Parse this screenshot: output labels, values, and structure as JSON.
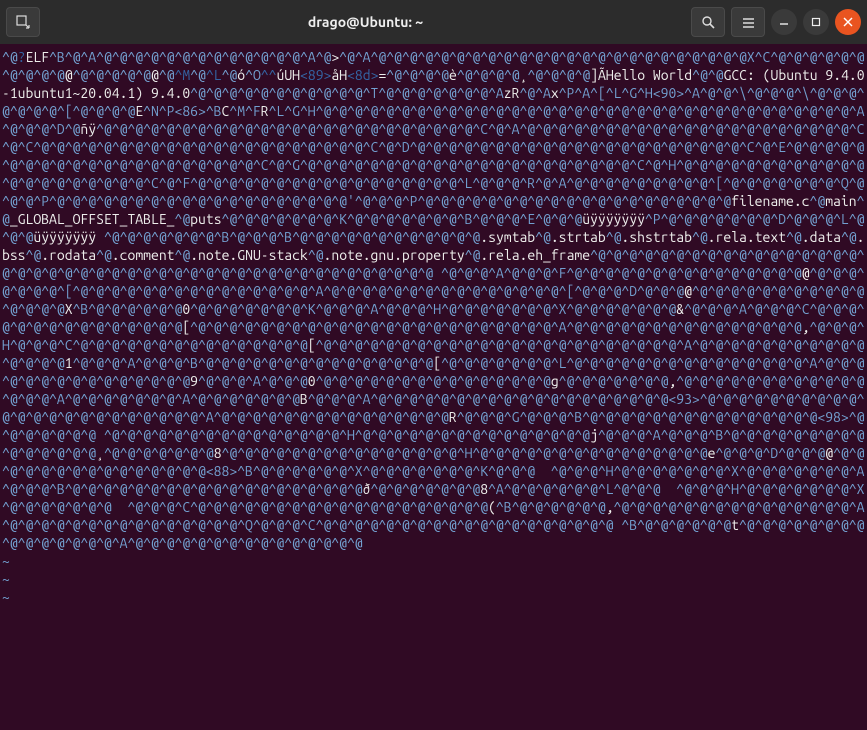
{
  "window": {
    "title": "drago@Ubuntu: ~"
  },
  "content": {
    "tokens": [
      {
        "c": "ctrl",
        "t": "^@"
      },
      {
        "c": "brkt",
        "t": "?"
      },
      {
        "c": "txt",
        "t": "ELF"
      },
      {
        "c": "ctrl",
        "t": "^B^@^A^@^@^@^@^@^@^@^@^@^@^@^@^@^A^@"
      },
      {
        "c": "txt",
        "t": ">"
      },
      {
        "c": "ctrl",
        "t": "^@^A^@^@^@^@^@^@^@^@^@^@^@^@^@^@^@^@^@^@^@^@^@^@^@^@X^C^@^@^@^@^@^@^@^@^@^@"
      },
      {
        "c": "txt",
        "t": "@"
      },
      {
        "c": "ctrl",
        "t": "^@^@^@^@^@"
      },
      {
        "c": "txt",
        "t": "@"
      },
      {
        "c": "ctrl",
        "t": "^@"
      },
      {
        "c": "brkt",
        "t": "^M"
      },
      {
        "c": "ctrl",
        "t": "^@"
      },
      {
        "c": "brkt",
        "t": "^L"
      },
      {
        "c": "ctrl",
        "t": "^@"
      },
      {
        "c": "txt",
        "t": "ó"
      },
      {
        "c": "ctrl",
        "t": "^O"
      },
      {
        "c": "brkt",
        "t": "^^"
      },
      {
        "c": "txt",
        "t": "úUH"
      },
      {
        "c": "brkt",
        "t": "<89>"
      },
      {
        "c": "txt",
        "t": "åH"
      },
      {
        "c": "brkt",
        "t": "<8d>"
      },
      {
        "c": "txt",
        "t": "="
      },
      {
        "c": "ctrl",
        "t": "^@^@^@^@"
      },
      {
        "c": "txt",
        "t": "è"
      },
      {
        "c": "ctrl",
        "t": "^@^@^@^@"
      },
      {
        "c": "txt",
        "t": "¸"
      },
      {
        "c": "ctrl",
        "t": "^@^@^@^@"
      },
      {
        "c": "txt",
        "t": "]ÃHello World"
      },
      {
        "c": "ctrl",
        "t": "^@^@"
      },
      {
        "c": "txt",
        "t": "GCC: (Ubuntu 9.4.0-1ubuntu1~20.04.1) 9.4.0"
      },
      {
        "c": "ctrl",
        "t": "^@^@^@^@^@^@^@^@^@^@^@^T^@^@^@^@^@^@^@^A"
      },
      {
        "c": "txt",
        "t": "zR"
      },
      {
        "c": "ctrl",
        "t": "^@^A"
      },
      {
        "c": "txt",
        "t": "x"
      },
      {
        "c": "ctrl",
        "t": "^P^A^[^L^G^H<90>^A^@^@^\\^@^@^@^\\^@^@^@^@^@^@^@^[^@^@^@^@"
      },
      {
        "c": "txt",
        "t": "E"
      },
      {
        "c": "ctrl",
        "t": "^N^P<86>^B"
      },
      {
        "c": "txt",
        "t": "C"
      },
      {
        "c": "ctrl",
        "t": "^M^F"
      },
      {
        "c": "txt",
        "t": "R"
      },
      {
        "c": "ctrl",
        "t": "^L^G^H^@^@^@^@^@^@^@^@^@^@^@^@^@^@^@^@^@^@^@^@^@^@^@^@^@^@^@^@^@^@^@^@^@^@^A^@^@^@^D^@"
      },
      {
        "c": "txt",
        "t": "ñÿ"
      },
      {
        "c": "ctrl",
        "t": "^@^@^@^@^@^@^@^@^@^@^@^@^@^@^@^@^@^@^@^@^@^@^@^@^C^@^A^@^@^@^@^@^@^@^@^@^@^@^@^@^@^@^@^@^@^@^@^@^C^@^C^@^@^@^@^@^@^@^@^@^@^@^@^@^@^@^@^@^@^@^@^@^C^@^D^@^@^@^@^@^@^@^@^@^@^@^@^@^@^@^@^@^@^@^@^@^C^@^E^@^@^@^@^@^@^@^@^@^@^@^@^@^@^@^@^@^@^@^@^@^C^@^G^@^@^@^@^@^@^@^@^@^@^@^@^@^@^@^@^@^@^@^@^@^C^@^H^@^@^@^@^@^@^@^@^@^@^@^@^@^@^@^@^@^@^@^@^@^C^@^F^@^@^@^@^@^@^@^@^@^@^@^@^@^@^@^@^@^L^@^@^@^R^@^A^@^@^@^@^@^@^@^@^@^[^@^@^@^@^@^@^@^Q^@^@^@^P^@^@^@^@^@^@^@^@^@^@^@^@^@^@^@^@^@^@^@'^@^@^@^P^@^@^@^@^@^@^@^@^@^@^@^@^@^@^@^@^@^@^@^@"
      },
      {
        "c": "txt",
        "t": "filename.c"
      },
      {
        "c": "ctrl",
        "t": "^@"
      },
      {
        "c": "txt",
        "t": "main"
      },
      {
        "c": "ctrl",
        "t": "^@"
      },
      {
        "c": "txt",
        "t": "_GLOBAL_OFFSET_TABLE_"
      },
      {
        "c": "ctrl",
        "t": "^@"
      },
      {
        "c": "txt",
        "t": "puts"
      },
      {
        "c": "ctrl",
        "t": "^@^@^@^@^@^@^@^K^@^@^@^@^@^@^@^B^@^@^@^E^@^@^@"
      },
      {
        "c": "txt",
        "t": "üÿÿÿÿÿÿÿ"
      },
      {
        "c": "ctrl",
        "t": "^P^@^@^@^@^@^@^@^D^@^@^@^L^@^@^@"
      },
      {
        "c": "txt",
        "t": "üÿÿÿÿÿÿÿ "
      },
      {
        "c": "ctrl",
        "t": "^@^@^@^@^@^@^@^B^@^@^@^B^@^@^@^@^@^@^@^@^@^@^@^@"
      },
      {
        "c": "txt",
        "t": ".symtab"
      },
      {
        "c": "ctrl",
        "t": "^@"
      },
      {
        "c": "txt",
        "t": ".strtab"
      },
      {
        "c": "ctrl",
        "t": "^@"
      },
      {
        "c": "txt",
        "t": ".shstrtab"
      },
      {
        "c": "ctrl",
        "t": "^@"
      },
      {
        "c": "txt",
        "t": ".rela.text"
      },
      {
        "c": "ctrl",
        "t": "^@"
      },
      {
        "c": "txt",
        "t": ".data"
      },
      {
        "c": "ctrl",
        "t": "^@"
      },
      {
        "c": "txt",
        "t": ".bss"
      },
      {
        "c": "ctrl",
        "t": "^@"
      },
      {
        "c": "txt",
        "t": ".rodata"
      },
      {
        "c": "ctrl",
        "t": "^@"
      },
      {
        "c": "txt",
        "t": ".comment"
      },
      {
        "c": "ctrl",
        "t": "^@"
      },
      {
        "c": "txt",
        "t": ".note.GNU-stack"
      },
      {
        "c": "ctrl",
        "t": "^@"
      },
      {
        "c": "txt",
        "t": ".note.gnu.property"
      },
      {
        "c": "ctrl",
        "t": "^@"
      },
      {
        "c": "txt",
        "t": ".rela.eh_frame"
      },
      {
        "c": "ctrl",
        "t": "^@^@^@^@^@^@^@^@^@^@^@^@^@^@^@^@^@^@^@^@^@^@^@^@^@^@^@^@^@^@^@^@^@^@^@^@^@^@^@^@^@^@^@^@^@ ^@^@^@^A^@^@^@^F^@^@^@^@^@^@^@^@^@^@^@^@^@^@^@"
      },
      {
        "c": "txt",
        "t": "@"
      },
      {
        "c": "ctrl",
        "t": "^@^@^@^@^@^@^@^[^@^@^@^@^@^@^@^@^@^@^@^@^@^@^@^A^@^@^@^@^@^@^@^@^@^@^@^@^@^@^@^[^@^@^@^D^@^@^@"
      },
      {
        "c": "txt",
        "t": "@"
      },
      {
        "c": "ctrl",
        "t": "^@^@^@^@^@^@^@^@^@^@^@^@^@^@^@"
      },
      {
        "c": "txt",
        "t": "X"
      },
      {
        "c": "ctrl",
        "t": "^B^@^@^@^@^@^@"
      },
      {
        "c": "txt",
        "t": "0"
      },
      {
        "c": "ctrl",
        "t": "^@^@^@^@^@^@^@^K^@^@^@^A^@^@^@^H^@^@^@^@^@^@^@^X^@^@^@^@^@^@^@"
      },
      {
        "c": "txt",
        "t": "&"
      },
      {
        "c": "ctrl",
        "t": "^@^@^@^A^@^@^@^C^@^@^@^@^@^@^@^@^@^@^@^@^@^@^@"
      },
      {
        "c": "txt",
        "t": "["
      },
      {
        "c": "ctrl",
        "t": "^@^@^@^@^@^@^@^@^@^@^@^@^@^@^@^@^@^@^@^@^@^@^@^A^@^@^@^@^@^@^@^@^@^@^@^@^@^@^@"
      },
      {
        "c": "txt",
        "t": ","
      },
      {
        "c": "ctrl",
        "t": "^@^@^@^H^@^@^@^C^@^@^@^@^@^@^@^@^@^@^@^@^@^@^@"
      },
      {
        "c": "txt",
        "t": "["
      },
      {
        "c": "ctrl",
        "t": "^@^@^@^@^@^@^@^@^@^@^@^@^@^@^@^@^@^@^@^@^@^@^@^A^@^@^@^@^@^@^@^@^@^@^@^@^@^@^@"
      },
      {
        "c": "txt",
        "t": "1"
      },
      {
        "c": "ctrl",
        "t": "^@^@^@^A^@^@^@^B^@^@^@^@^@^@^@^@^@^@^@^@^@^@^@"
      },
      {
        "c": "txt",
        "t": "["
      },
      {
        "c": "ctrl",
        "t": "^@^@^@^@^@^@^@^L^@^@^@^@^@^@^@^@^@^@^@^@^@^@^@^A^@^@^@^@^@^@^@^@^@^@^@^@^@^@^@"
      },
      {
        "c": "txt",
        "t": "9"
      },
      {
        "c": "ctrl",
        "t": "^@^@^@^A^@^@^@"
      },
      {
        "c": "txt",
        "t": "0"
      },
      {
        "c": "ctrl",
        "t": "^@^@^@^@^@^@^@^@^@^@^@^@^@^@^@"
      },
      {
        "c": "txt",
        "t": "g"
      },
      {
        "c": "ctrl",
        "t": "^@^@^@^@^@^@^@"
      },
      {
        "c": "txt",
        "t": ","
      },
      {
        "c": "ctrl",
        "t": "^@^@^@^@^@^@^@^@^@^@^@^@^@^@^@^A^@^@^@^@^@^@^@^A^@^@^@^@^@^@^@"
      },
      {
        "c": "txt",
        "t": "B"
      },
      {
        "c": "ctrl",
        "t": "^@^@^@^A^@^@^@^@^@^@^@^@^@^@^@^@^@^@^@^@^@^@^@<93>^@^@^@^@^@^@^@^@^@^@^@^@^@^@^@^@^@^@^@^@^@^@^@^A^@^@^@^@^@^@^@^@^@^@^@^@^@^@^@"
      },
      {
        "c": "txt",
        "t": "R"
      },
      {
        "c": "ctrl",
        "t": "^@^@^@^G^@^@^@^B^@^@^@^@^@^@^@^@^@^@^@^@^@^@^@<98>^@^@^@^@^@^@^@ ^@^@^@^@^@^@^@^@^@^@^@^@^@^@^@^H^@^@^@^@^@^@^@^@^@^@^@^@^@^@^@"
      },
      {
        "c": "txt",
        "t": "j"
      },
      {
        "c": "ctrl",
        "t": "^@^@^@^A^@^@^@^B^@^@^@^@^@^@^@^@^@^@^@^@^@^@^@"
      },
      {
        "c": "txt",
        "t": "¸"
      },
      {
        "c": "ctrl",
        "t": "^@^@^@^@^@^@^@"
      },
      {
        "c": "txt",
        "t": "8"
      },
      {
        "c": "ctrl",
        "t": "^@^@^@^@^@^@^@^@^@^@^@^@^@^@^@^H^@^@^@^@^@^@^@^@^@^@^@^@^@^@^@"
      },
      {
        "c": "txt",
        "t": "e"
      },
      {
        "c": "ctrl",
        "t": "^@^@^@^D^@^@^@"
      },
      {
        "c": "txt",
        "t": "@"
      },
      {
        "c": "ctrl",
        "t": "^@^@^@^@^@^@^@^@^@^@^@^@^@^@^@<88>^B^@^@^@^@^@^@^X^@^@^@^@^@^@^@^K^@^@^@  ^@^@^@^H^@^@^@^@^@^@^@^X^@^@^@^@^@^@^@^A^@^@^@^B^@^@^@^@^@^@^@^@^@^@^@^@^@^@^@^@^@^@^@"
      },
      {
        "c": "txt",
        "t": "ð"
      },
      {
        "c": "ctrl",
        "t": "^@^@^@^@^@^@^@"
      },
      {
        "c": "txt",
        "t": "8"
      },
      {
        "c": "ctrl",
        "t": "^A^@^@^@^@^@^@^L^@^@^@  ^@^@^@^H^@^@^@^@^@^@^@^X^@^@^@^@^@^@^@  ^@^@^@^C^@^@^@^@^@^@^@^@^@^@^@^@^@^@^@^@^@^@^@"
      },
      {
        "c": "txt",
        "t": "("
      },
      {
        "c": "ctrl",
        "t": "^B^@^@^@^@^@^@"
      },
      {
        "c": "txt",
        "t": ","
      },
      {
        "c": "ctrl",
        "t": "^@^@^@^@^@^@^@^@^@^@^@^@^@^@^@^A^@^@^@^@^@^@^@^@^@^@^@^@^@^@^@^Q^@^@^@^C^@^@^@^@^@^@^@^@^@^@^@^@^@^@^@^@^@^@^@ ^B^@^@^@^@^@^@"
      },
      {
        "c": "txt",
        "t": "t"
      },
      {
        "c": "ctrl",
        "t": "^@^@^@^@^@^@^@^@^@^@^@^@^@^@^@^A^@^@^@^@^@^@^@^@^@^@^@^@^@^@^@"
      }
    ],
    "tildes": [
      "~",
      "~",
      "~"
    ]
  }
}
